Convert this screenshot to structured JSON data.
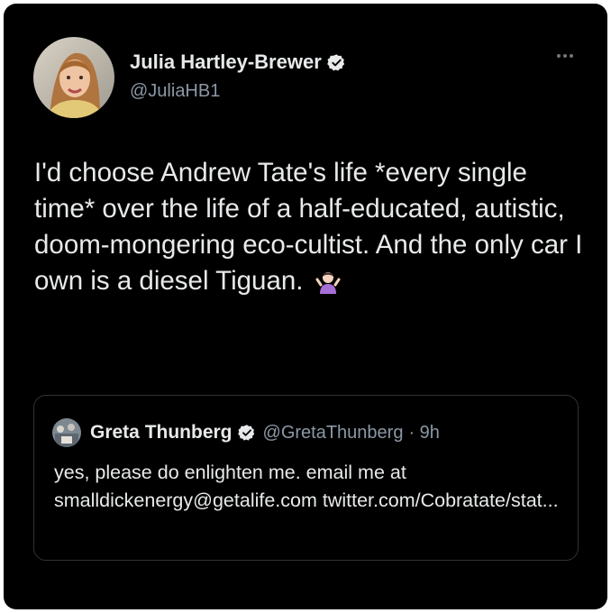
{
  "tweet": {
    "author": {
      "name": "Julia Hartley-Brewer",
      "handle": "@JuliaHB1",
      "verified_icon": "verified-badge-icon"
    },
    "more_icon": "more-options-icon",
    "text": "I'd choose Andrew Tate's life *every single time* over the life of a half-educated, autistic, doom-mongering eco-cultist. And the only car I own is a diesel Tiguan.",
    "emoji_icon": "person-shrugging-emoji-icon",
    "quote": {
      "author": {
        "name": "Greta Thunberg",
        "handle": "@GretaThunberg",
        "time": "· 9h",
        "verified_icon": "verified-badge-icon"
      },
      "text": "yes, please do enlighten me. email me at smalldickenergy@getalife.com twitter.com/Cobratate/stat..."
    }
  },
  "colors": {
    "background": "#000000",
    "primary_text": "#e7e9ea",
    "secondary_text": "#8b98a5",
    "border": "#2f3336",
    "badge": "#1d9bf0"
  }
}
